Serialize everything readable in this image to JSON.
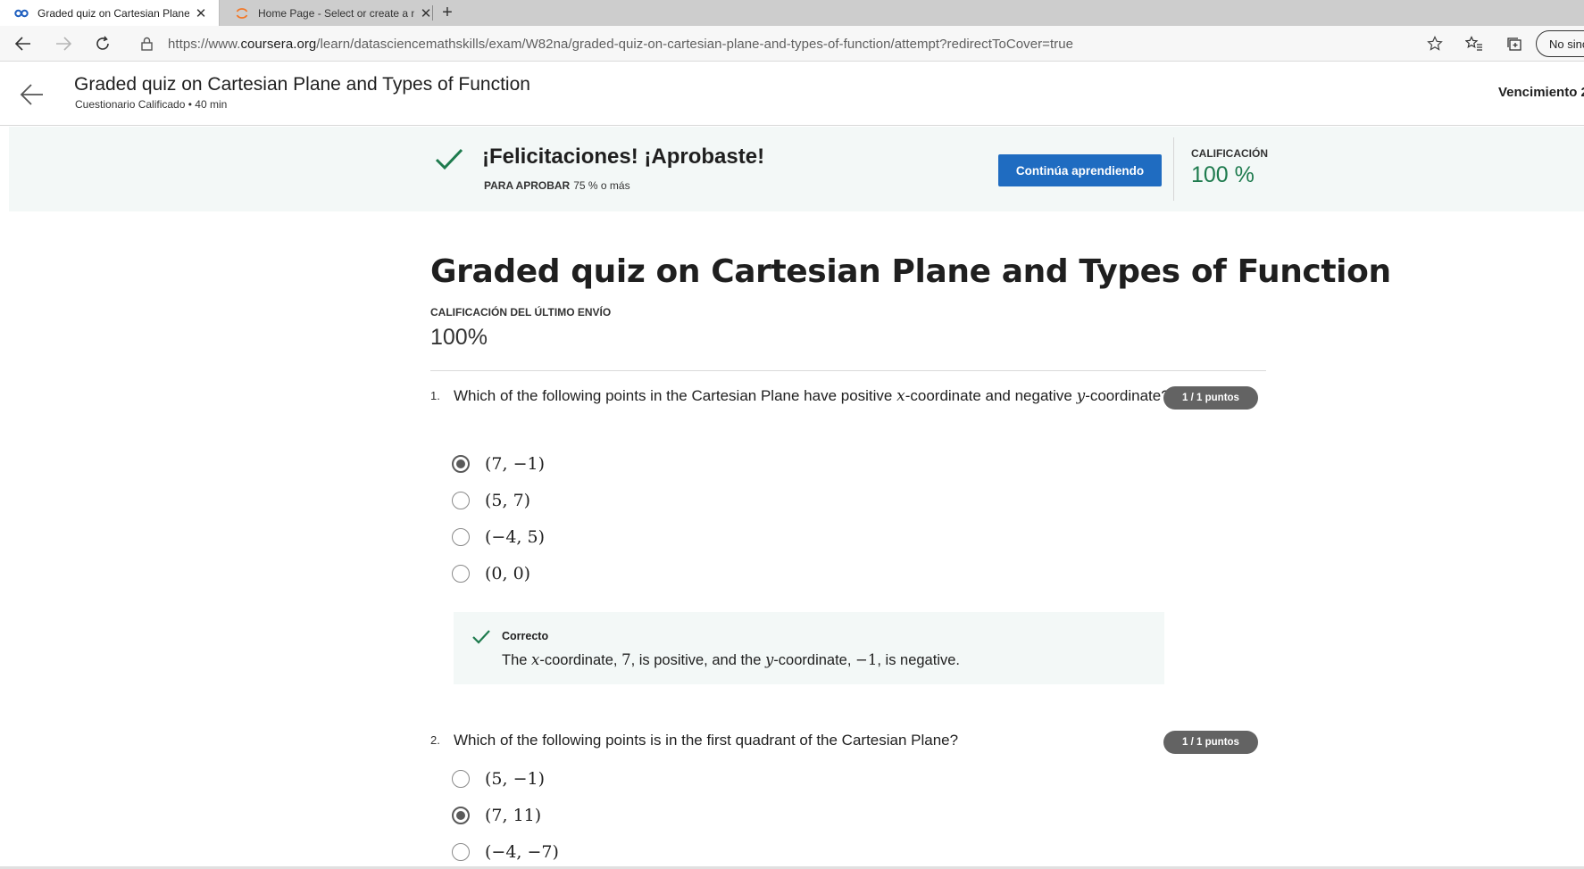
{
  "browser": {
    "tabs": [
      {
        "title": "Graded quiz on Cartesian Plane and Types of Function",
        "icon": "coursera-icon",
        "active": true
      },
      {
        "title": "Home Page - Select or create a notebook",
        "icon": "jupyter-icon",
        "active": false
      }
    ],
    "url_prefix": "https://www.",
    "url_host": "coursera.org",
    "url_path": "/learn/datasciencemathskills/exam/W82na/graded-quiz-on-cartesian-plane-and-types-of-function/attempt?redirectToCover=true",
    "sync_label": "No sincronizado"
  },
  "header": {
    "title": "Graded quiz on Cartesian Plane and Types of Function",
    "subtitle": "Cuestionario Calificado • 40 min",
    "due_label": "Vencimiento 2"
  },
  "banner": {
    "title": "¡Felicitaciones! ¡Aprobaste!",
    "pass_label": "PARA APROBAR",
    "pass_value": "75 % o más",
    "continue_label": "Continúa aprendiendo",
    "grade_label": "CALIFICACIÓN",
    "grade_value": "100 %",
    "accent_color": "#1e7b4e",
    "button_color": "#1f6cc1"
  },
  "quiz": {
    "title": "Graded quiz on Cartesian Plane and Types of Function",
    "last_submission_label": "CALIFICACIÓN DEL ÚLTIMO ENVÍO",
    "last_submission_value": "100%",
    "questions": [
      {
        "number": "1.",
        "text_a": "Which of the following points in the Cartesian Plane have positive ",
        "var_x": "x",
        "text_b": "-coordinate and negative ",
        "var_y": "y",
        "text_c": "-coordinate?",
        "points": "1 / 1 puntos",
        "options": [
          "(7, −1)",
          "(5, 7)",
          "(−4, 5)",
          "(0, 0)"
        ],
        "selected_index": 0,
        "feedback_title": "Correcto",
        "feedback_a": "The ",
        "feedback_x": "x",
        "feedback_b": "-coordinate, ",
        "feedback_n1": "7",
        "feedback_c": ", is positive, and the ",
        "feedback_y": "y",
        "feedback_d": "-coordinate, ",
        "feedback_n2": "−1",
        "feedback_e": ", is negative."
      },
      {
        "number": "2.",
        "text": "Which of the following points is in the first quadrant of the Cartesian Plane?",
        "points": "1 / 1 puntos",
        "options": [
          "(5, −1)",
          "(7, 11)",
          "(−4, −7)"
        ],
        "selected_index": 1
      }
    ]
  }
}
